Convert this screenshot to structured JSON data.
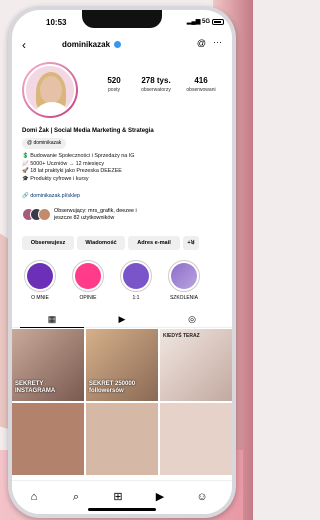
{
  "status": {
    "time": "10:53",
    "network": "5G"
  },
  "header": {
    "username": "dominikazak"
  },
  "stats": [
    {
      "value": "520",
      "label": "posty"
    },
    {
      "value": "278 tys.",
      "label": "obserwatorzy"
    },
    {
      "value": "416",
      "label": "obserwowani"
    }
  ],
  "profile": {
    "name": "Domi Żak | Social Media Marketing & Strategia",
    "threads_handle": "dominikazak",
    "bio_lines": [
      "💲 Budowanie Społeczności i Sprzedaży na IG",
      "📈 5000+ Uczniów → 12 miesięcy",
      "🚀 18 lat praktyki jako Prezeska DEEZEE",
      "🎓 Produkty cyfrowe i kursy"
    ],
    "link": "dominikazak.pl/sklep",
    "followed_by_line1": "Obserwujący: mrs_grafik, deezee i",
    "followed_by_line2": "jeszcze 82 użytkowników"
  },
  "buttons": {
    "following": "Obserwujesz",
    "message": "Wiadomość",
    "email": "Adres e-mail",
    "add_person": "+ꓤ"
  },
  "highlights": [
    {
      "label": "O MNIE",
      "color": "#6b2fb8"
    },
    {
      "label": "OPINIE",
      "color": "#ff3b8a"
    },
    {
      "label": "1:1",
      "color": "#7a55c9"
    },
    {
      "label": "SZKOLENIA",
      "color": "#8e6cc9"
    }
  ],
  "grid": {
    "post1_caption": "SEKRETY INSTAGRAMA",
    "post2_caption": "SEKRET 250000 followersów",
    "post3_caption": "KIEDYŚ TERAZ"
  },
  "colors": {
    "accent": "#3897f0",
    "link": "#00376b"
  }
}
